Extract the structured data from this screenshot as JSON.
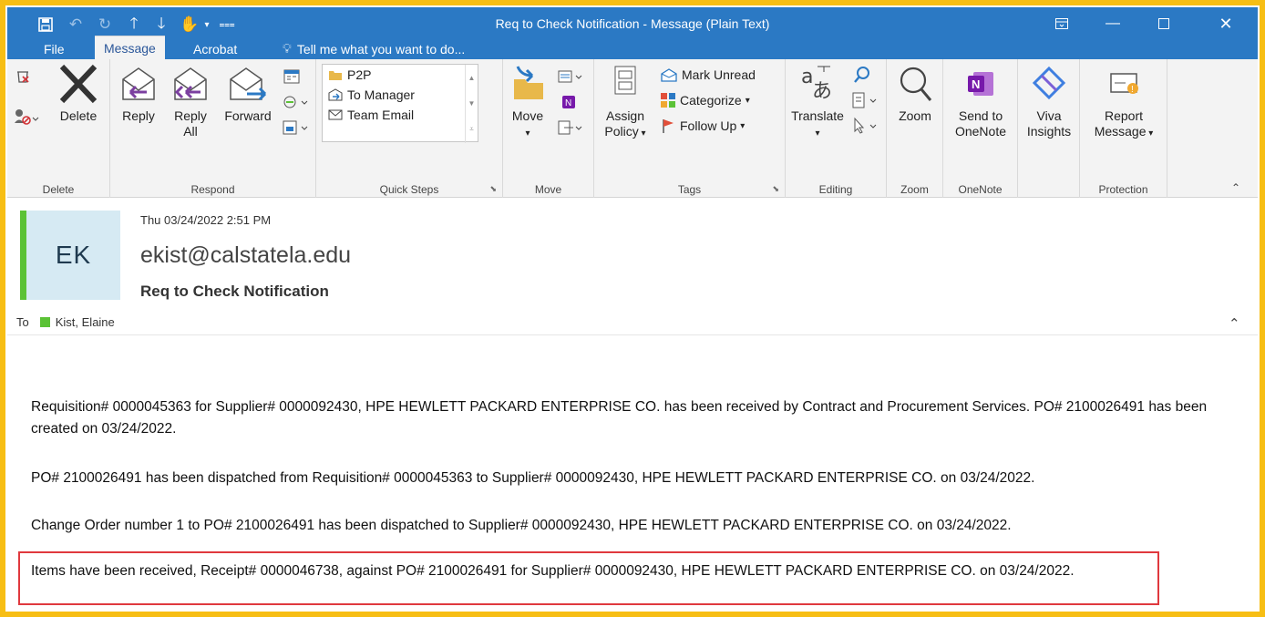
{
  "window": {
    "title": "Req to Check Notification - Message (Plain Text)",
    "titlebar_color": "#2B79C4",
    "highlight_border_color": "#F7BE14"
  },
  "quick_access": [
    "save-icon",
    "undo-icon",
    "redo-icon",
    "up-arrow-icon",
    "down-arrow-icon",
    "touch-mode-icon",
    "dropdown-icon",
    "customize-icon"
  ],
  "tabs": {
    "file": "File",
    "message": "Message",
    "acrobat": "Acrobat",
    "tell_me": "Tell me what you want to do..."
  },
  "ribbon": {
    "delete_group": {
      "label": "Delete",
      "delete_button": "Delete"
    },
    "respond_group": {
      "label": "Respond",
      "reply": "Reply",
      "reply_all_line1": "Reply",
      "reply_all_line2": "All",
      "forward": "Forward"
    },
    "quick_steps_group": {
      "label": "Quick Steps",
      "items": [
        "P2P",
        "To Manager",
        "Team Email"
      ]
    },
    "move_group": {
      "label": "Move",
      "move": "Move"
    },
    "tags_group": {
      "label": "Tags",
      "assign_policy_line1": "Assign",
      "assign_policy_line2": "Policy",
      "mark_unread": "Mark Unread",
      "categorize": "Categorize",
      "follow_up": "Follow Up"
    },
    "editing_group": {
      "label": "Editing",
      "translate": "Translate"
    },
    "zoom_group": {
      "label": "Zoom",
      "zoom": "Zoom"
    },
    "onenote_group": {
      "label": "OneNote",
      "send_line1": "Send to",
      "send_line2": "OneNote"
    },
    "viva_group": {
      "viva_line1": "Viva",
      "viva_line2": "Insights"
    },
    "protection_group": {
      "label": "Protection",
      "report_line1": "Report",
      "report_line2": "Message"
    }
  },
  "message": {
    "date": "Thu 03/24/2022 2:51 PM",
    "avatar_initials": "EK",
    "sender": "ekist@calstatela.edu",
    "subject": "Req to Check Notification",
    "to_label": "To",
    "recipient": "Kist, Elaine",
    "body": [
      "Requisition# 0000045363 for Supplier# 0000092430, HPE HEWLETT PACKARD ENTERPRISE CO. has been received by Contract and Procurement Services.  PO# 2100026491 has been created on 03/24/2022.",
      "PO# 2100026491 has been dispatched from Requisition# 0000045363 to Supplier# 0000092430, HPE HEWLETT PACKARD ENTERPRISE CO. on 03/24/2022.",
      "Change Order number 1 to PO# 2100026491 has been dispatched to Supplier# 0000092430, HPE HEWLETT PACKARD ENTERPRISE CO. on 03/24/2022.",
      "Items have been received, Receipt# 0000046738, against PO# 2100026491 for Supplier# 0000092430, HPE HEWLETT PACKARD ENTERPRISE CO. on 03/24/2022."
    ]
  }
}
